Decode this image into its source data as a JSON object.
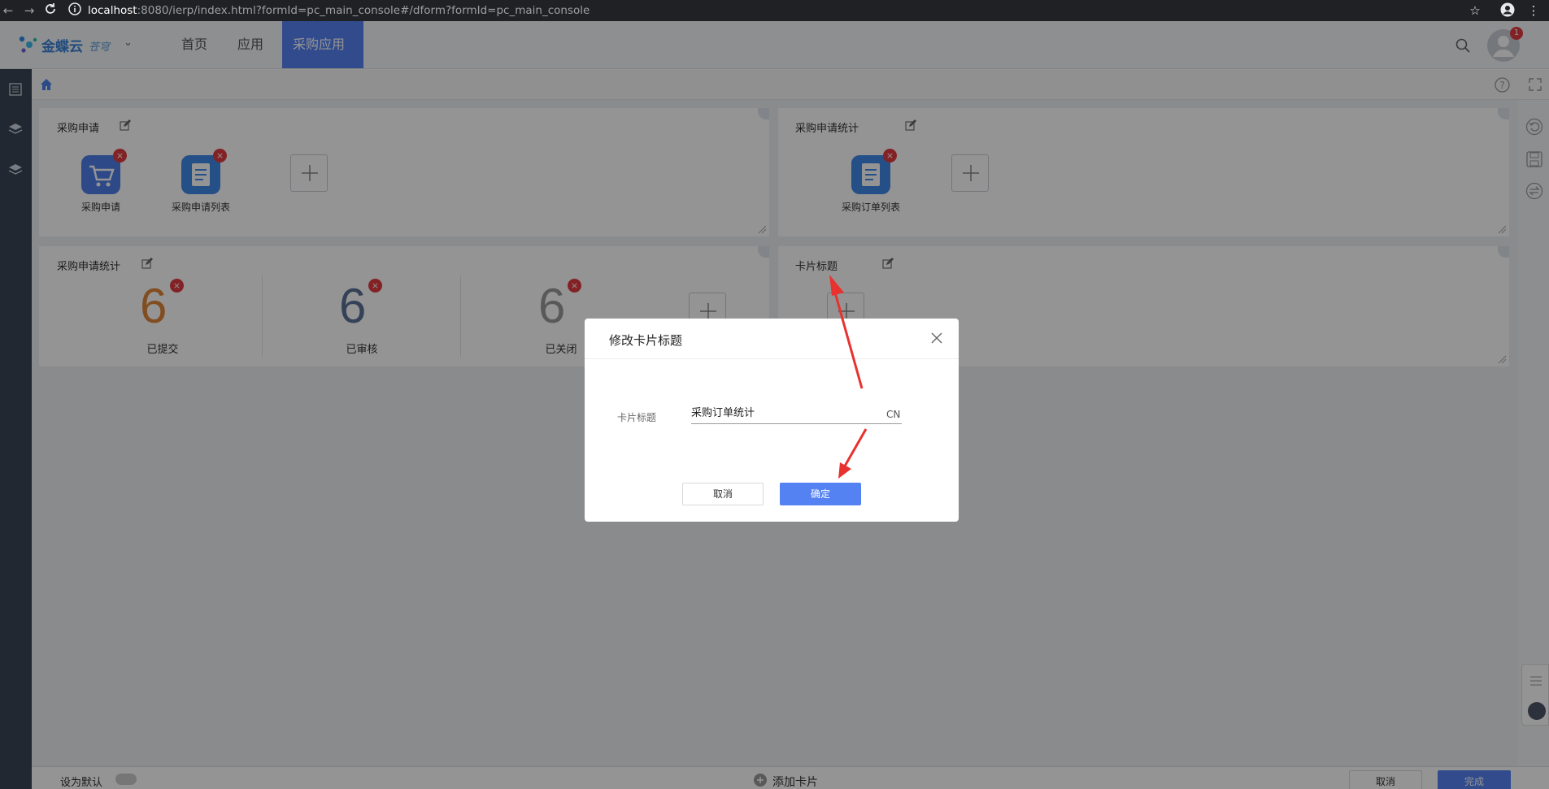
{
  "browser": {
    "url_host": "localhost",
    "url_path": ":8080/ierp/index.html?formId=pc_main_console#/dform?formId=pc_main_console",
    "notification_count": "1"
  },
  "header": {
    "brand": "金蝶云",
    "brand_sub": "苍穹",
    "nav_tabs": [
      {
        "label": "首页",
        "active": false
      },
      {
        "label": "应用",
        "active": false
      },
      {
        "label": "采购应用",
        "active": true
      }
    ]
  },
  "cards": {
    "purchase_request": {
      "title": "采购申请",
      "apps": [
        {
          "label": "采购申请",
          "icon": "shopping-cart-icon"
        },
        {
          "label": "采购申请列表",
          "icon": "document-list-icon"
        }
      ]
    },
    "purchase_request_stats_top": {
      "title": "采购申请统计",
      "apps": [
        {
          "label": "采购订单列表",
          "icon": "document-list-icon"
        }
      ]
    },
    "purchase_request_stats": {
      "title": "采购申请统计",
      "stats": [
        {
          "value": "6",
          "label": "已提交",
          "color": "#e0863a"
        },
        {
          "value": "6",
          "label": "已审核",
          "color": "#5a7196"
        },
        {
          "value": "6",
          "label": "已关闭",
          "color": "#9a9a9a"
        }
      ]
    },
    "card_title": {
      "title": "卡片标题"
    }
  },
  "bottom_bar": {
    "left_label": "设为默认",
    "center_label": "添加卡片",
    "cancel_label": "取消",
    "done_label": "完成"
  },
  "dialog": {
    "title": "修改卡片标题",
    "field_label": "卡片标题",
    "field_value": "采购订单统计",
    "lang": "CN",
    "cancel_label": "取消",
    "ok_label": "确定"
  },
  "colors": {
    "accent": "#5582f3",
    "sidebar": "#3c4555",
    "delete_badge": "#e23b41",
    "annotation_arrow": "#e8322f"
  }
}
